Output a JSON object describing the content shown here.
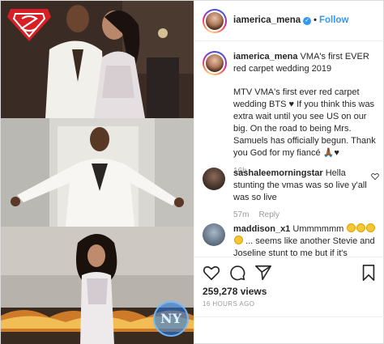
{
  "colors": {
    "accent_blue": "#3897f0",
    "text": "#262626",
    "muted": "#999999",
    "border": "#efefef"
  },
  "header": {
    "username": "iamerica_mena",
    "verified_icon": "verified-badge",
    "separator": "•",
    "follow_label": "Follow"
  },
  "caption": {
    "username": "iamerica_mena",
    "line1": "VMA's first EVER red carpet wedding 2019",
    "line2": "MTV VMA's first ever red carpet wedding BTS ♥ If you think this was extra wait until you see US on our big. On the road to being Mrs. Samuels has officially begun. Thank you God for my fiancé 🙏🏾♥",
    "time": "16h"
  },
  "comments": [
    {
      "username": "sashaleemorningstar",
      "text": "Hella stunting the vmas was so live y'all was so live",
      "time": "57m",
      "reply_label": "Reply"
    },
    {
      "username": "maddison_x1",
      "text_a": "Ummmmmm",
      "text_b": "... seems like another Stevie and Joseline stunt to me but if it's"
    }
  ],
  "actions": {
    "icons": [
      "heart-icon",
      "comment-icon",
      "share-icon",
      "bookmark-icon"
    ]
  },
  "stats": {
    "views": "259,278 views",
    "age": "16 HOURS AGO"
  },
  "watermark": {
    "logo_text": "NY"
  }
}
